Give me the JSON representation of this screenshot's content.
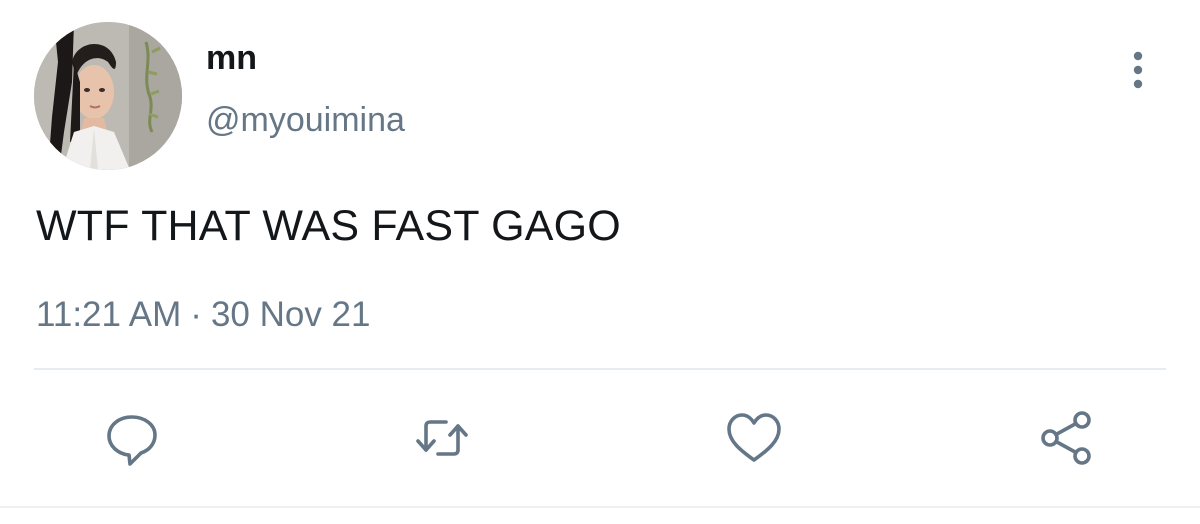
{
  "tweet": {
    "author": {
      "display_name": "mn",
      "handle": "@myouimina"
    },
    "text": "WTF THAT WAS FAST GAGO",
    "time": "11:21 AM",
    "separator": "·",
    "date": "30 Nov 21"
  },
  "icons": {
    "more": "more-vertical-icon",
    "reply": "reply-bubble-icon",
    "retweet": "retweet-icon",
    "like": "heart-icon",
    "share": "share-icon"
  },
  "colors": {
    "text_primary": "#14171a",
    "text_secondary": "#657786",
    "icon_gray": "#657786",
    "divider": "#e6ecf0",
    "background": "#ffffff"
  }
}
